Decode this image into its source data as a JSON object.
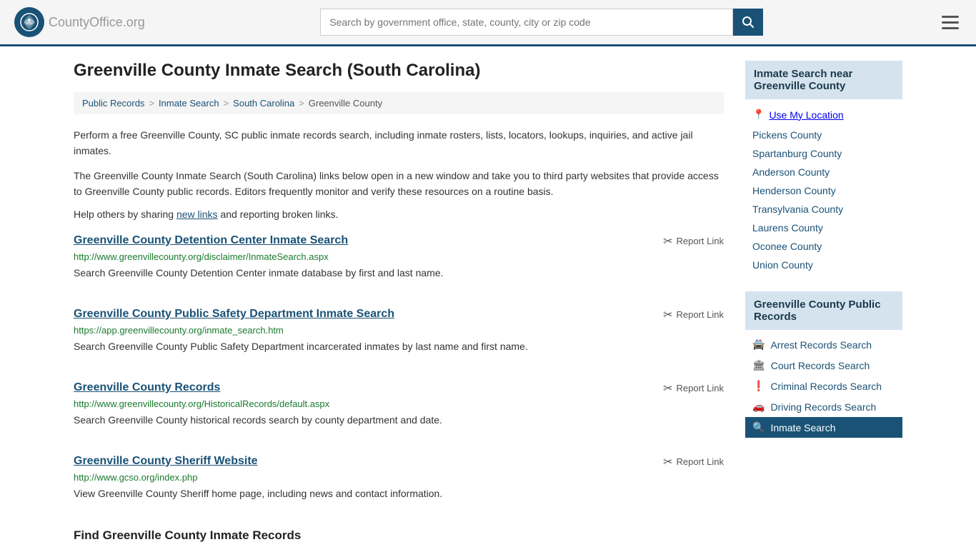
{
  "header": {
    "logo_text": "CountyOffice",
    "logo_tld": ".org",
    "search_placeholder": "Search by government office, state, county, city or zip code",
    "search_btn_label": "Search"
  },
  "page": {
    "title": "Greenville County Inmate Search (South Carolina)"
  },
  "breadcrumb": {
    "items": [
      {
        "label": "Public Records",
        "href": "#"
      },
      {
        "label": "Inmate Search",
        "href": "#"
      },
      {
        "label": "South Carolina",
        "href": "#"
      },
      {
        "label": "Greenville County",
        "href": "#"
      }
    ]
  },
  "description": {
    "para1": "Perform a free Greenville County, SC public inmate records search, including inmate rosters, lists, locators, lookups, inquiries, and active jail inmates.",
    "para2": "The Greenville County Inmate Search (South Carolina) links below open in a new window and take you to third party websites that provide access to Greenville County public records. Editors frequently monitor and verify these resources on a routine basis.",
    "help": "Help others by sharing",
    "new_links": "new links",
    "help_end": "and reporting broken links."
  },
  "results": [
    {
      "id": "result-1",
      "title": "Greenville County Detention Center Inmate Search",
      "url": "http://www.greenvillecounty.org/disclaimer/InmateSearch.aspx",
      "desc": "Search Greenville County Detention Center inmate database by first and last name.",
      "report": "Report Link"
    },
    {
      "id": "result-2",
      "title": "Greenville County Public Safety Department Inmate Search",
      "url": "https://app.greenvillecounty.org/inmate_search.htm",
      "desc": "Search Greenville County Public Safety Department incarcerated inmates by last name and first name.",
      "report": "Report Link"
    },
    {
      "id": "result-3",
      "title": "Greenville County Records",
      "url": "http://www.greenvillecounty.org/HistoricalRecords/default.aspx",
      "desc": "Search Greenville County historical records search by county department and date.",
      "report": "Report Link"
    },
    {
      "id": "result-4",
      "title": "Greenville County Sheriff Website",
      "url": "http://www.gcso.org/index.php",
      "desc": "View Greenville County Sheriff home page, including news and contact information.",
      "report": "Report Link"
    }
  ],
  "find_heading": "Find Greenville County Inmate Records",
  "sidebar": {
    "nearby_header": "Inmate Search near Greenville County",
    "use_my_location": "Use My Location",
    "nearby_counties": [
      "Pickens County",
      "Spartanburg County",
      "Anderson County",
      "Henderson County",
      "Transylvania County",
      "Laurens County",
      "Oconee County",
      "Union County"
    ],
    "public_records_header": "Greenville County Public Records",
    "public_records": [
      {
        "label": "Arrest Records Search",
        "icon": "🚔"
      },
      {
        "label": "Court Records Search",
        "icon": "🏛"
      },
      {
        "label": "Criminal Records Search",
        "icon": "❗"
      },
      {
        "label": "Driving Records Search",
        "icon": "🚗"
      },
      {
        "label": "Inmate Search",
        "icon": "🔍",
        "active": true
      }
    ]
  }
}
